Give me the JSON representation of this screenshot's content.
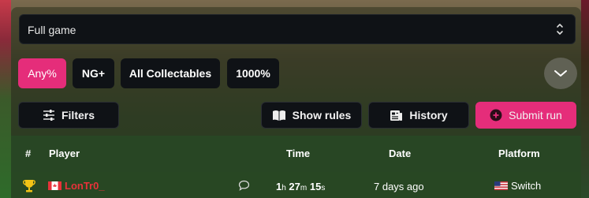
{
  "category_select": {
    "value": "Full game"
  },
  "filter_chips": [
    {
      "label": "Any%",
      "active": true
    },
    {
      "label": "NG+",
      "active": false
    },
    {
      "label": "All Collectables",
      "active": false
    },
    {
      "label": "1000%",
      "active": false
    }
  ],
  "actions": {
    "filters_label": "Filters",
    "show_rules_label": "Show rules",
    "history_label": "History",
    "submit_label": "Submit run"
  },
  "table": {
    "headers": {
      "rank": "#",
      "player": "Player",
      "time": "Time",
      "date": "Date",
      "platform": "Platform"
    },
    "rows": [
      {
        "rank_icon": "trophy-icon",
        "player_flag": "canada-flag-icon",
        "player": "LonTr0_",
        "has_comment": true,
        "time_h": "1",
        "time_h_unit": "h",
        "time_m": "27",
        "time_m_unit": "m",
        "time_s": "15",
        "time_s_unit": "s",
        "date": "7 days ago",
        "platform_flag": "usa-flag-icon",
        "platform": "Switch"
      }
    ]
  },
  "colors": {
    "accent": "#e52d7a",
    "dark_surface": "#0f1216",
    "player_red": "#e8323a"
  }
}
